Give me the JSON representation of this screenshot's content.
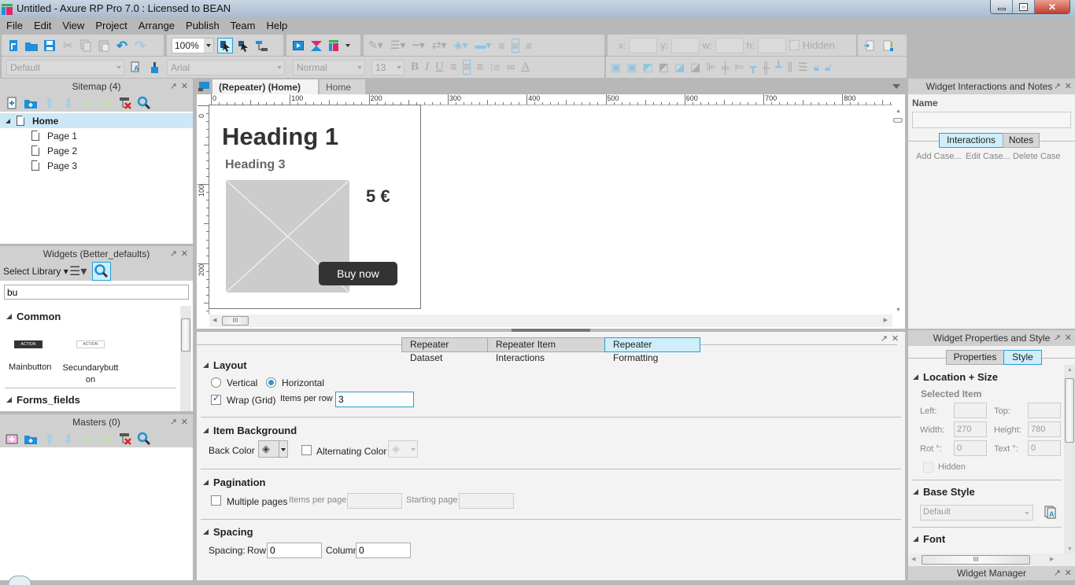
{
  "window": {
    "title": "Untitled - Axure RP Pro 7.0 : Licensed to BEAN",
    "minimize_icon": "minimize-icon",
    "restore_icon": "restore-icon",
    "close_icon": "close-icon"
  },
  "menu": [
    "File",
    "Edit",
    "View",
    "Project",
    "Arrange",
    "Publish",
    "Team",
    "Help"
  ],
  "toolbar": {
    "zoom": "100%",
    "x_label": "x:",
    "y_label": "y:",
    "w_label": "w:",
    "h_label": "h:",
    "hidden_label": "Hidden",
    "style_select": "Default",
    "font_select": "Arial",
    "weight_select": "Normal",
    "size_select": "13",
    "bold": "B",
    "italic": "I",
    "underline": "U",
    "font_color": "A"
  },
  "sitemap": {
    "title": "Sitemap (4)",
    "pages": [
      {
        "label": "Home",
        "selected": true
      },
      {
        "label": "Page 1"
      },
      {
        "label": "Page 2"
      },
      {
        "label": "Page 3"
      }
    ]
  },
  "widgets": {
    "title": "Widgets (Better_defaults)",
    "select_library": "Select Library",
    "search_value": "bu",
    "sections": [
      {
        "label": "Common",
        "items": [
          {
            "label": "Mainbutton",
            "preview": "ACTION"
          },
          {
            "label": "Secundarybutton",
            "preview": "ACTION"
          }
        ]
      },
      {
        "label": "Forms_fields"
      }
    ]
  },
  "masters": {
    "title": "Masters (0)"
  },
  "canvas": {
    "tabs": [
      {
        "label": "(Repeater) (Home)",
        "active": true
      },
      {
        "label": "Home",
        "active": false
      }
    ],
    "ruler_h": [
      "0",
      "100",
      "200",
      "300",
      "400",
      "500",
      "600",
      "700",
      "800"
    ],
    "ruler_v": [
      "0",
      "100",
      "200"
    ],
    "repeater_item": {
      "heading1": "Heading 1",
      "heading3": "Heading 3",
      "price": "5 €",
      "button": "Buy now"
    }
  },
  "repeater_panel": {
    "tabs": [
      {
        "label": "Repeater Dataset",
        "active": false
      },
      {
        "label": "Repeater Item Interactions",
        "active": false
      },
      {
        "label": "Repeater Formatting",
        "active": true
      }
    ],
    "layout": {
      "title": "Layout",
      "vertical": "Vertical",
      "horizontal": "Horizontal",
      "selected": "Horizontal",
      "wrap_label": "Wrap (Grid)",
      "wrap_checked": true,
      "items_per_row_label": "Items per row",
      "items_per_row": "3"
    },
    "item_background": {
      "title": "Item Background",
      "back_color_label": "Back Color",
      "alternating_label": "Alternating Color",
      "alternating_checked": false
    },
    "pagination": {
      "title": "Pagination",
      "multiple_pages_label": "Multiple pages",
      "multiple_pages_checked": false,
      "items_per_page_label": "Items per page",
      "items_per_page": "",
      "starting_page_label": "Starting page",
      "starting_page": ""
    },
    "spacing": {
      "title": "Spacing",
      "label": "Spacing:",
      "row_label": "Row",
      "row": "0",
      "column_label": "Column",
      "column": "0"
    }
  },
  "interactions_panel": {
    "title": "Widget Interactions and Notes",
    "name_label": "Name",
    "name_value": "",
    "tabs": [
      {
        "label": "Interactions",
        "active": true
      },
      {
        "label": "Notes",
        "active": false
      }
    ],
    "add_case": "Add Case...",
    "edit_case": "Edit Case...",
    "delete_case": "Delete Case"
  },
  "properties_panel": {
    "title": "Widget Properties and Style",
    "tabs": [
      {
        "label": "Properties",
        "active": false
      },
      {
        "label": "Style",
        "active": true
      }
    ],
    "location_size": {
      "title": "Location + Size",
      "selected_item": "Selected Item",
      "left_label": "Left:",
      "left": "",
      "top_label": "Top:",
      "top": "",
      "width_label": "Width:",
      "width": "270",
      "height_label": "Height:",
      "height": "780",
      "rot_label": "Rot °:",
      "rot": "0",
      "text_label": "Text °:",
      "text": "0",
      "hidden_label": "Hidden"
    },
    "base_style": {
      "title": "Base Style",
      "value": "Default"
    },
    "font": {
      "title": "Font"
    }
  },
  "widget_manager": {
    "title": "Widget Manager"
  },
  "colors": {
    "accent_blue": "#2b9bd5",
    "active_tab": "#cdeefa",
    "selected_row": "#cce8f6",
    "button_dark": "#333333",
    "placeholder_grey": "#cccccc"
  }
}
